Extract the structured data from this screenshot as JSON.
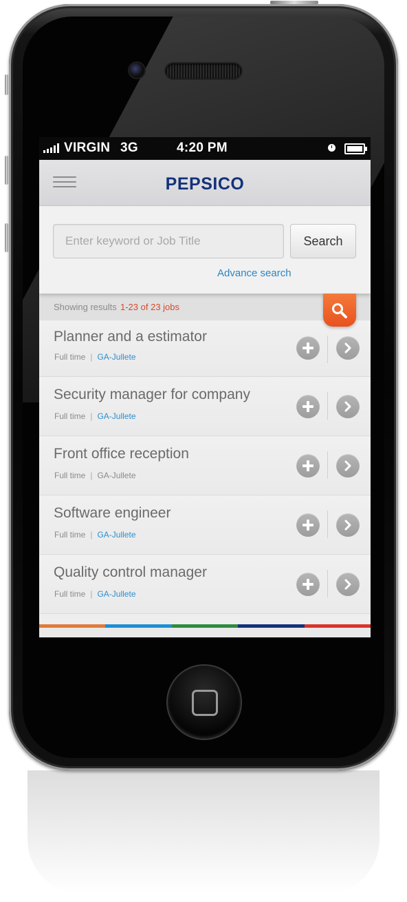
{
  "status_bar": {
    "carrier": "VIRGIN",
    "network": "3G",
    "time": "4:20 PM"
  },
  "header": {
    "logo_text": "PEPSICO",
    "menu_icon": "hamburger-menu-icon"
  },
  "search": {
    "placeholder": "Enter keyword or Job Title",
    "button_label": "Search",
    "advance_link": "Advance search"
  },
  "results": {
    "label": "Showing results",
    "count_text": "1-23 of 23 jobs",
    "fab_icon": "search-icon"
  },
  "jobs": [
    {
      "title": "Planner and a estimator",
      "type": "Full time",
      "location": "GA-Jullete"
    },
    {
      "title": "Security manager for company",
      "type": "Full time",
      "location": "GA-Jullete"
    },
    {
      "title": "Front office reception",
      "type": "Full time",
      "location": "GA-Jullete"
    },
    {
      "title": "Software engineer",
      "type": "Full time",
      "location": "GA-Jullete"
    },
    {
      "title": "Quality control manager",
      "type": "Full time",
      "location": "GA-Jullete"
    }
  ],
  "colors": {
    "brand_blue": "#14327a",
    "link_blue": "#2b86c5",
    "accent_orange": "#e8521f",
    "count_red": "#d8482a",
    "strip": [
      "#e07b3a",
      "#1e8fd6",
      "#2e8b3e",
      "#14327a",
      "#d9342b"
    ]
  }
}
